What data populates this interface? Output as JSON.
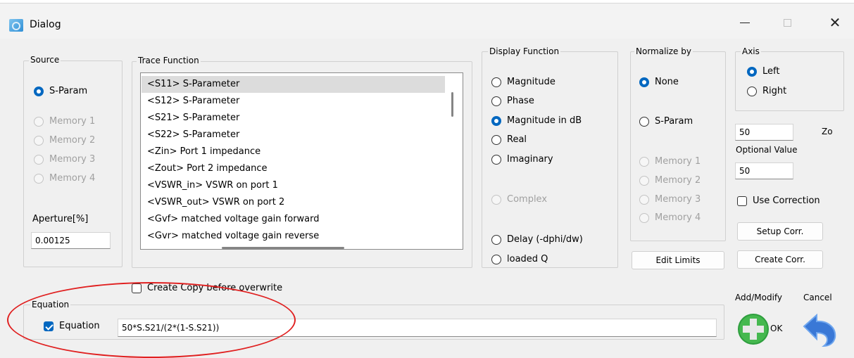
{
  "window": {
    "title": "Dialog",
    "minimize_icon": "minimize-icon",
    "maximize_icon": "maximize-icon",
    "close_icon": "close-icon"
  },
  "source": {
    "label": "Source",
    "options": [
      {
        "label": "S-Param",
        "checked": true,
        "enabled": true
      },
      {
        "label": "Memory 1",
        "checked": false,
        "enabled": false
      },
      {
        "label": "Memory 2",
        "checked": false,
        "enabled": false
      },
      {
        "label": "Memory 3",
        "checked": false,
        "enabled": false
      },
      {
        "label": "Memory 4",
        "checked": false,
        "enabled": false
      }
    ],
    "aperture_label": "Aperture[%]",
    "aperture_value": "0.00125"
  },
  "trace_function": {
    "label": "Trace Function",
    "items": [
      "<S11> S-Parameter",
      "<S12> S-Parameter",
      "<S21> S-Parameter",
      "<S22> S-Parameter",
      "<Zin> Port 1 impedance",
      "<Zout> Port 2 impedance",
      "<VSWR_in> VSWR on port 1",
      "<VSWR_out> VSWR on port 2",
      "<Gvf> matched voltage gain forward",
      "<Gvr> matched voltage gain reverse"
    ],
    "selected": "<S11> S-Parameter"
  },
  "display_function": {
    "label": "Display Function",
    "options": [
      {
        "label": "Magnitude",
        "checked": false,
        "enabled": true
      },
      {
        "label": "Phase",
        "checked": false,
        "enabled": true
      },
      {
        "label": "Magnitude in dB",
        "checked": true,
        "enabled": true
      },
      {
        "label": "Real",
        "checked": false,
        "enabled": true
      },
      {
        "label": "Imaginary",
        "checked": false,
        "enabled": true
      },
      {
        "label": "Complex",
        "checked": false,
        "enabled": false
      },
      {
        "label": "Delay (-dphi/dw)",
        "checked": false,
        "enabled": true
      },
      {
        "label": "loaded Q",
        "checked": false,
        "enabled": true
      }
    ]
  },
  "normalize_by": {
    "label": "Normalize by",
    "options": [
      {
        "label": "None",
        "checked": true,
        "enabled": true
      },
      {
        "label": "S-Param",
        "checked": false,
        "enabled": true
      },
      {
        "label": "Memory 1",
        "checked": false,
        "enabled": false
      },
      {
        "label": "Memory 2",
        "checked": false,
        "enabled": false
      },
      {
        "label": "Memory 3",
        "checked": false,
        "enabled": false
      },
      {
        "label": "Memory 4",
        "checked": false,
        "enabled": false
      }
    ],
    "edit_limits": "Edit Limits"
  },
  "axis": {
    "label": "Axis",
    "options": [
      {
        "label": "Left",
        "checked": true
      },
      {
        "label": "Right",
        "checked": false
      }
    ],
    "zo_value": "50",
    "zo_label": "Zo",
    "optional_label": "Optional Value",
    "optional_value": "50",
    "use_correction": "Use Correction",
    "setup_corr": "Setup Corr.",
    "create_corr": "Create Corr."
  },
  "copy_checkbox": "Create Copy before overwrite",
  "equation": {
    "group_label": "Equation",
    "checkbox_label": "Equation",
    "checked": true,
    "value": "50*S.S21/(2*(1-S.S21))"
  },
  "actions": {
    "add_modify_label": "Add/Modify",
    "ok_label": "OK",
    "cancel_label": "Cancel",
    "add_icon": "plus-icon",
    "cancel_icon": "undo-arrow-icon"
  },
  "colors": {
    "accent": "#0067c0",
    "annotation": "#e02020",
    "add_green": "#2e9e3e"
  }
}
